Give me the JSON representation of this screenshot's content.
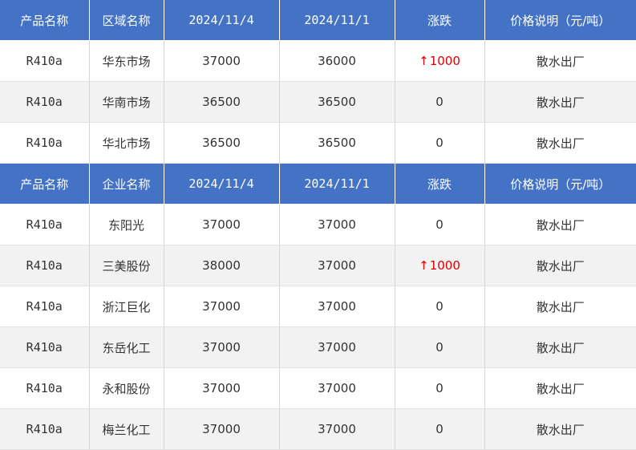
{
  "colors": {
    "header_bg": "#4472c4",
    "header_text": "#ffffff",
    "row_alt_bg": "#f2f2f2",
    "up": "#e00000"
  },
  "table1": {
    "headers": [
      "产品名称",
      "区域名称",
      "2024/11/4",
      "2024/11/1",
      "涨跌",
      "价格说明（元/吨）"
    ],
    "rows": [
      {
        "product": "R410a",
        "name": "华东市场",
        "price_new": "37000",
        "price_old": "36000",
        "change": "1000",
        "change_dir": "up",
        "note": "散水出厂"
      },
      {
        "product": "R410a",
        "name": "华南市场",
        "price_new": "36500",
        "price_old": "36500",
        "change": "0",
        "change_dir": "flat",
        "note": "散水出厂"
      },
      {
        "product": "R410a",
        "name": "华北市场",
        "price_new": "36500",
        "price_old": "36500",
        "change": "0",
        "change_dir": "flat",
        "note": "散水出厂"
      }
    ]
  },
  "table2": {
    "headers": [
      "产品名称",
      "企业名称",
      "2024/11/4",
      "2024/11/1",
      "涨跌",
      "价格说明（元/吨）"
    ],
    "rows": [
      {
        "product": "R410a",
        "name": "东阳光",
        "price_new": "37000",
        "price_old": "37000",
        "change": "0",
        "change_dir": "flat",
        "note": "散水出厂"
      },
      {
        "product": "R410a",
        "name": "三美股份",
        "price_new": "38000",
        "price_old": "37000",
        "change": "1000",
        "change_dir": "up",
        "note": "散水出厂"
      },
      {
        "product": "R410a",
        "name": "浙江巨化",
        "price_new": "37000",
        "price_old": "37000",
        "change": "0",
        "change_dir": "flat",
        "note": "散水出厂"
      },
      {
        "product": "R410a",
        "name": "东岳化工",
        "price_new": "37000",
        "price_old": "37000",
        "change": "0",
        "change_dir": "flat",
        "note": "散水出厂"
      },
      {
        "product": "R410a",
        "name": "永和股份",
        "price_new": "37000",
        "price_old": "37000",
        "change": "0",
        "change_dir": "flat",
        "note": "散水出厂"
      },
      {
        "product": "R410a",
        "name": "梅兰化工",
        "price_new": "37000",
        "price_old": "37000",
        "change": "0",
        "change_dir": "flat",
        "note": "散水出厂"
      }
    ]
  }
}
